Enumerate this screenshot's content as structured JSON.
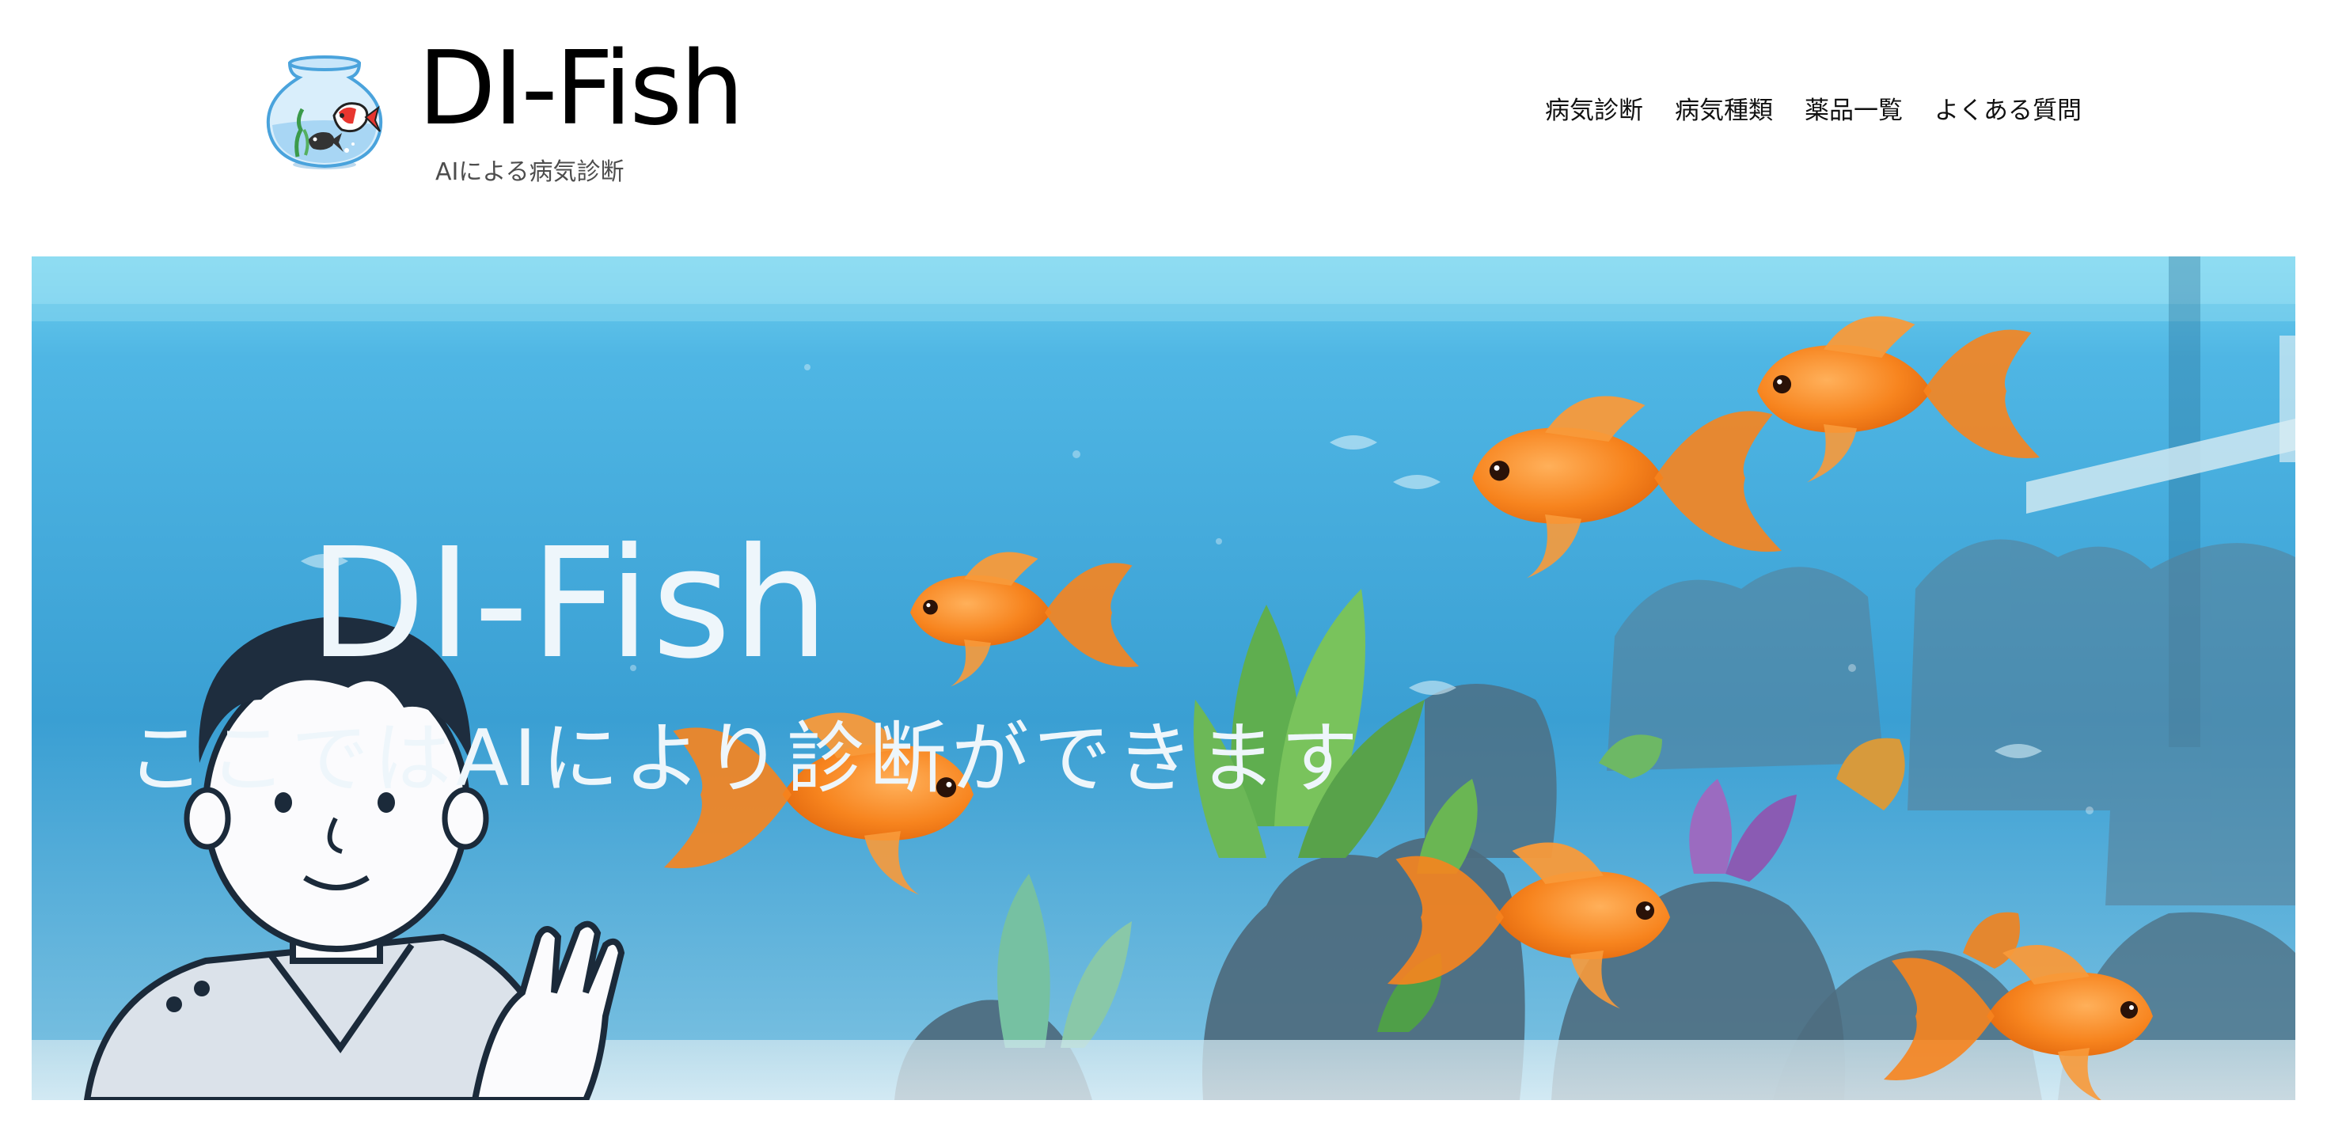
{
  "header": {
    "logo_icon": "goldfish-bowl-icon",
    "title": "DI-Fish",
    "tagline": "AIによる病気診断"
  },
  "nav": {
    "items": [
      {
        "label": "病気診断"
      },
      {
        "label": "病気種類"
      },
      {
        "label": "薬品一覧"
      },
      {
        "label": "よくある質問"
      }
    ]
  },
  "hero": {
    "title": "DI-Fish",
    "subtitle": "ここではAIにより診断ができます",
    "colors": {
      "water_top": "#6fd0ee",
      "water_mid": "#3a9fd3",
      "water_bottom": "#7fc3e2",
      "goldfish": "#f7841e"
    }
  }
}
